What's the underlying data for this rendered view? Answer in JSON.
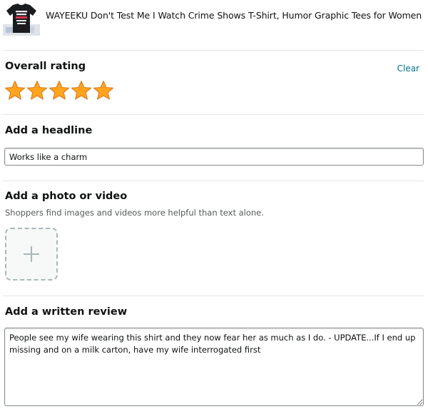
{
  "product": {
    "title": "WAYEEKU Don't Test Me I Watch Crime Shows T-Shirt, Humor Graphic Tees for Women, Short Sle..."
  },
  "rating": {
    "title": "Overall rating",
    "clear_label": "Clear",
    "value": 5,
    "max": 5,
    "star_color": "#ffa41c"
  },
  "headline": {
    "title": "Add a headline",
    "value": "Works like a charm"
  },
  "media": {
    "title": "Add a photo or video",
    "subtitle": "Shoppers find images and videos more helpful than text alone."
  },
  "review": {
    "title": "Add a written review",
    "value": "People see my wife wearing this shirt and they now fear her as much as I do. - UPDATE...If I end up missing and on a milk carton, have my wife interrogated first"
  }
}
